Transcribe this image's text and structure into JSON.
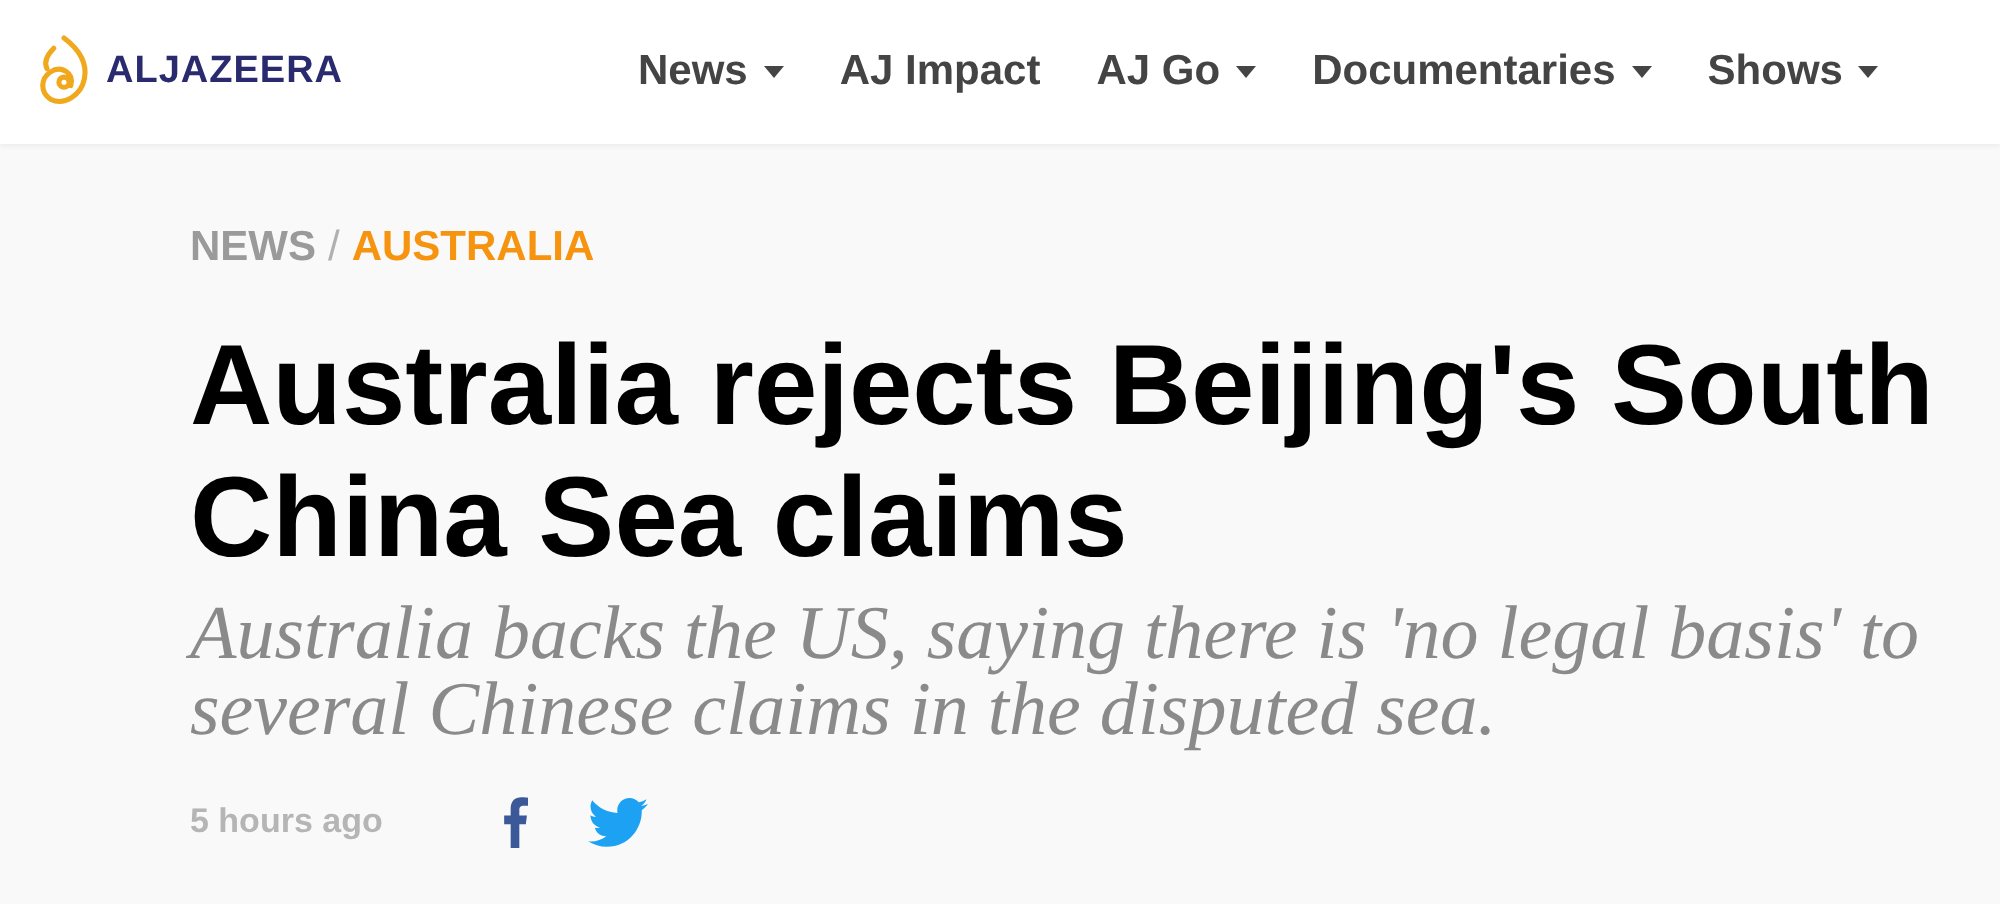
{
  "header": {
    "logo_text": "ALJAZEERA",
    "nav": [
      {
        "label": "News",
        "has_dropdown": true
      },
      {
        "label": "AJ Impact",
        "has_dropdown": false
      },
      {
        "label": "AJ Go",
        "has_dropdown": true
      },
      {
        "label": "Documentaries",
        "has_dropdown": true
      },
      {
        "label": "Shows",
        "has_dropdown": true
      }
    ]
  },
  "article": {
    "breadcrumb": {
      "section": "NEWS",
      "separator": "/",
      "region": "AUSTRALIA"
    },
    "headline": [
      "Australia rejects Beijing's South",
      "China Sea claims"
    ],
    "subtitle": "Australia backs the US, saying there is 'no legal basis' to several Chinese claims in the disputed sea.",
    "timestamp": "5 hours ago"
  }
}
